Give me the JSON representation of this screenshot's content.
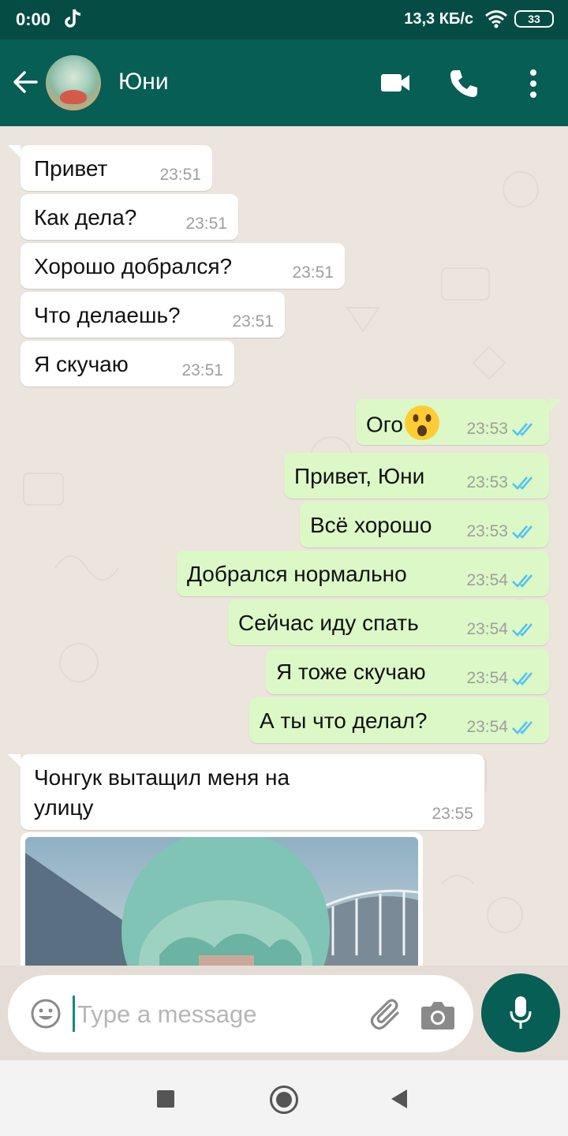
{
  "status_bar": {
    "time": "0:00",
    "network_speed": "13,3 КБ/с",
    "battery": "33"
  },
  "header": {
    "contact_name": "Юни"
  },
  "messages": [
    {
      "dir": "in",
      "text": "Привет",
      "time": "23:51"
    },
    {
      "dir": "in",
      "text": "Как дела?",
      "time": "23:51"
    },
    {
      "dir": "in",
      "text": "Хорошо добрался?",
      "time": "23:51"
    },
    {
      "dir": "in",
      "text": "Что делаешь?",
      "time": "23:51"
    },
    {
      "dir": "in",
      "text": "Я скучаю",
      "time": "23:51"
    },
    {
      "dir": "out",
      "text": "Ого",
      "emoji": "astonished-face-icon",
      "time": "23:53",
      "status": "read"
    },
    {
      "dir": "out",
      "text": "Привет, Юни",
      "time": "23:53",
      "status": "read"
    },
    {
      "dir": "out",
      "text": "Всё хорошо",
      "time": "23:53",
      "status": "read"
    },
    {
      "dir": "out",
      "text": "Добрался нормально",
      "time": "23:54",
      "status": "read"
    },
    {
      "dir": "out",
      "text": "Сейчас иду спать",
      "time": "23:54",
      "status": "read"
    },
    {
      "dir": "out",
      "text": "Я тоже скучаю",
      "time": "23:54",
      "status": "read"
    },
    {
      "dir": "out",
      "text": "А ты что делал?",
      "time": "23:54",
      "status": "read"
    },
    {
      "dir": "in",
      "text_line1": "Чонгук вытащил меня на",
      "text_line2": "улицу",
      "time": "23:55"
    }
  ],
  "composer": {
    "placeholder": "Type a message"
  },
  "colors": {
    "header": "#075e54",
    "status_bar": "#054d44",
    "outgoing_bubble": "#dcf8c6",
    "incoming_bubble": "#ffffff",
    "read_ticks": "#4fc3f7"
  }
}
